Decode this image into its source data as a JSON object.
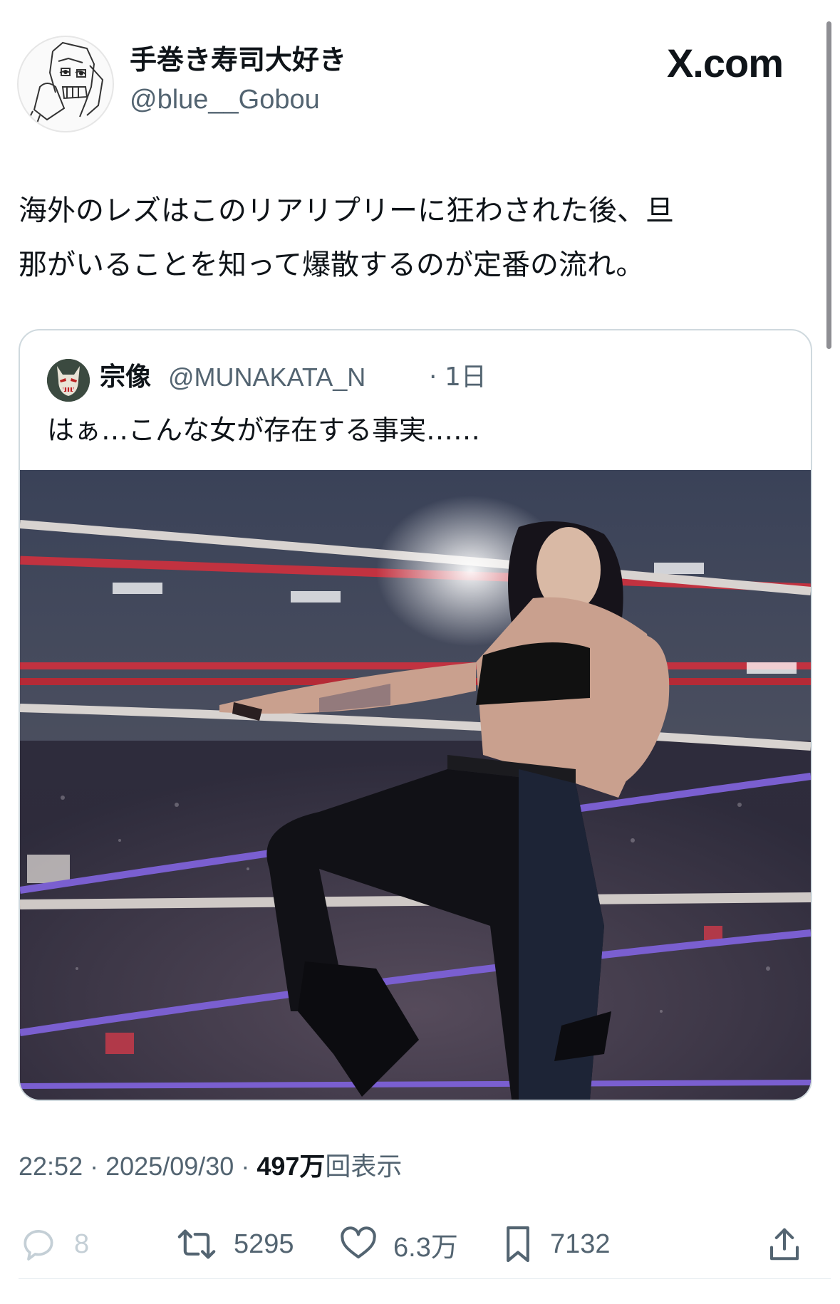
{
  "author": {
    "display_name": "手巻き寿司大好き",
    "handle": "@blue__Gobou",
    "avatar_icon": "sketch-avatar"
  },
  "brand_label": "X.com",
  "tweet": {
    "line1": "海外のレズはこのリアリプリーに狂わされた後、旦",
    "line2": "那がいることを知って爆散するのが定番の流れ。"
  },
  "quoted": {
    "display_name": "宗像",
    "handle": "@MUNAKATA_N",
    "separator": "·",
    "time": "1日",
    "text": "はぁ…こんな女が存在する事実……",
    "avatar_icon": "demon-mask-avatar",
    "photo": "wrestler-in-ring-photo"
  },
  "meta": {
    "time": "22:52",
    "separator1": "·",
    "date": "2025/09/30",
    "separator2": "·",
    "views_count": "497万",
    "views_label": "回表示"
  },
  "actions": {
    "replies": "8",
    "retweets": "5295",
    "likes": "6.3万",
    "bookmarks": "7132"
  },
  "colors": {
    "text": "#0f1419",
    "secondary": "#536471",
    "border": "#cfd9de"
  }
}
